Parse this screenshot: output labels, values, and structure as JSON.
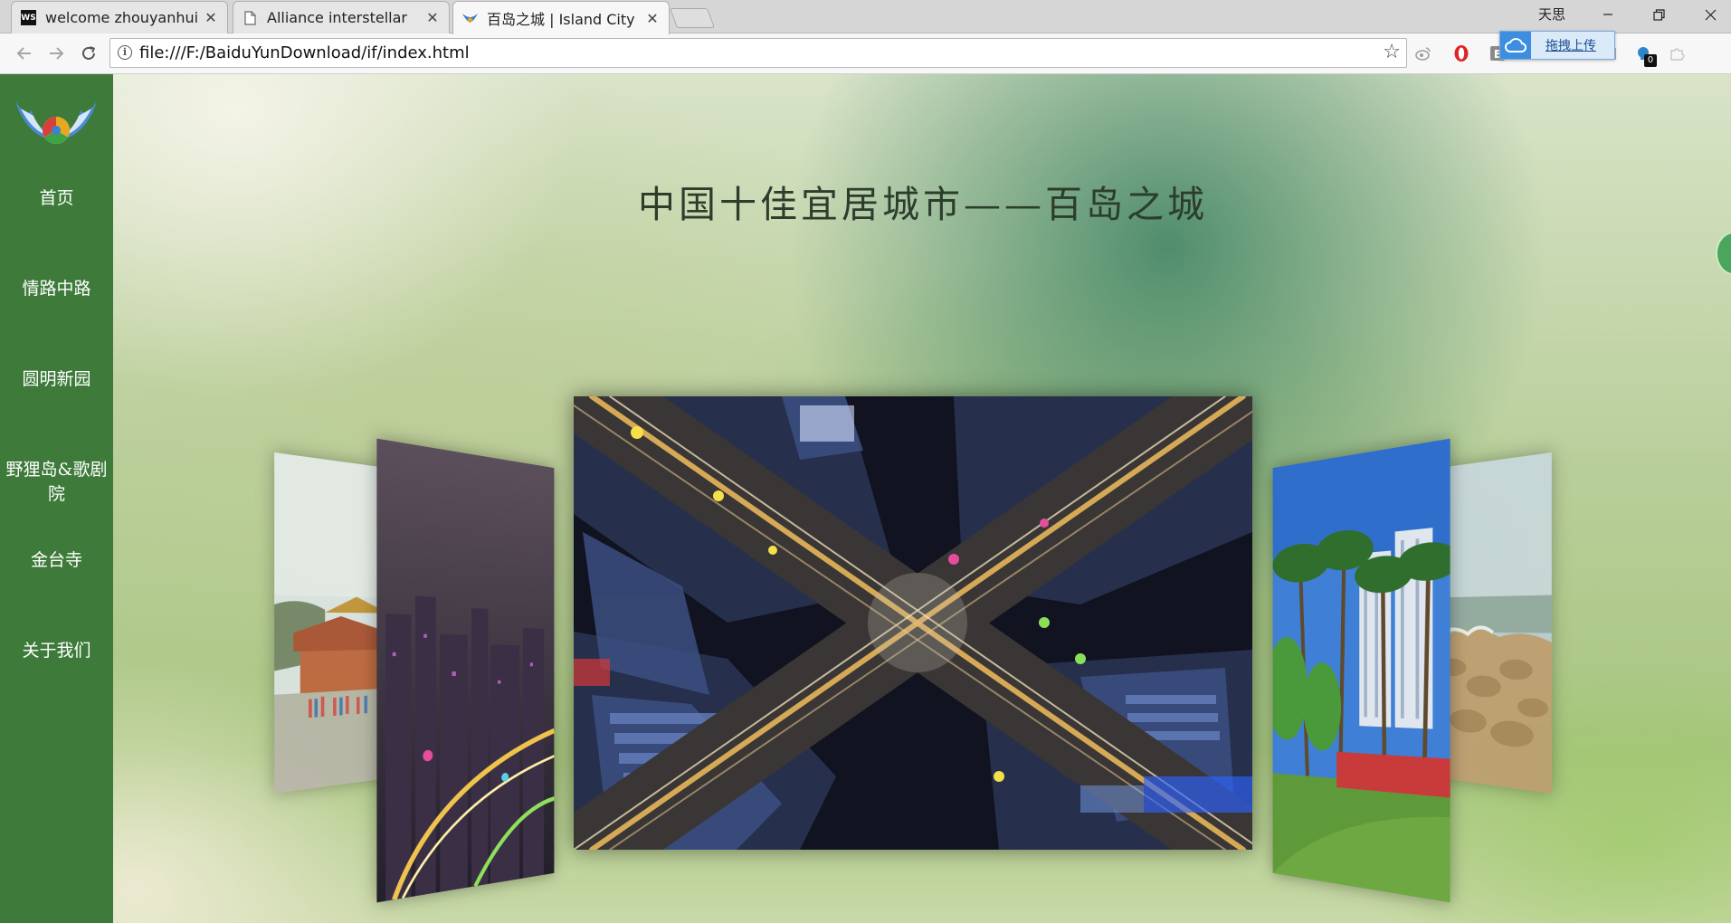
{
  "browser": {
    "tabs": [
      {
        "title": "welcome zhouyanhui C",
        "favicon": "webstorm-icon",
        "active": false
      },
      {
        "title": "Alliance interstellar",
        "favicon": "document-icon",
        "active": false
      },
      {
        "title": "百岛之城 | Island City",
        "favicon": "wings-logo-icon",
        "active": true
      }
    ],
    "close_glyph": "✕",
    "user": "天思",
    "url": "file:///F:/BaiduYunDownload/if/index.html",
    "upload_tip": "拖拽上传",
    "notification_count": "0"
  },
  "sidebar": {
    "items": [
      {
        "label": "首页"
      },
      {
        "label": "情路中路"
      },
      {
        "label": "圆明新园"
      },
      {
        "label": "野狸岛&歌剧院"
      },
      {
        "label": "金台寺"
      },
      {
        "label": "关于我们"
      }
    ]
  },
  "main": {
    "title": "中国十佳宜居城市——百岛之城"
  },
  "carousel": {
    "slides": [
      {
        "name": "temple-plaza-photo"
      },
      {
        "name": "night-city-skyline-photo"
      },
      {
        "name": "night-intersection-aerial-photo"
      },
      {
        "name": "palm-park-photo"
      },
      {
        "name": "rocky-seashore-photo"
      }
    ]
  },
  "colors": {
    "sidebar": "#3e7b3b",
    "title_text": "#2c3d2c",
    "background": "#b9cf9b"
  }
}
